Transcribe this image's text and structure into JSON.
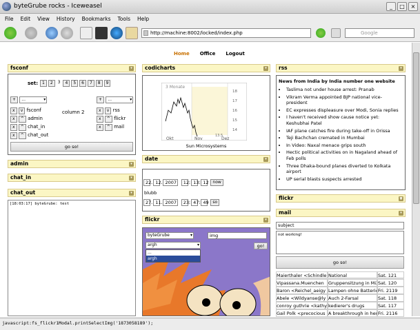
{
  "window": {
    "title": "byteGrube rocks - Iceweasel",
    "btn_min": "_",
    "btn_max": "□",
    "btn_close": "×"
  },
  "menu": [
    "File",
    "Edit",
    "View",
    "History",
    "Bookmarks",
    "Tools",
    "Help"
  ],
  "url": "http://machine:8002/locked/index.php",
  "search_placeholder": "Google",
  "nav": {
    "home": "Home",
    "office": "Office",
    "logout": "Logout"
  },
  "fsconf": {
    "title": "fsconf",
    "set_label": "set:",
    "sets": [
      "1",
      "2",
      "3",
      "4",
      "5",
      "6",
      "7",
      "8",
      "9"
    ],
    "col1_select": "...",
    "col2_label": "column 2",
    "col3_select": "...",
    "col1_items": [
      "fsconf",
      "admin",
      "chat_in",
      "chat_out"
    ],
    "col3_items": [
      "rss",
      "flickr",
      "mail"
    ],
    "go": "go so!"
  },
  "admin": {
    "title": "admin"
  },
  "chat_in": {
    "title": "chat_in"
  },
  "chat_out": {
    "title": "chat_out",
    "line": "[18:03:17] byteGrube: test"
  },
  "codicharts": {
    "title": "codicharts",
    "label": "3 Monate",
    "yticks": [
      "18",
      "17",
      "16",
      "15",
      "14",
      "13.5"
    ],
    "xticks": [
      "Okt",
      "Nov",
      "Dez"
    ],
    "caption": "Sun Microsystems"
  },
  "date": {
    "title": "date",
    "row1": [
      "22",
      "12",
      "2007",
      "12",
      "13",
      "12"
    ],
    "now": "now",
    "note": "blubb",
    "row2": [
      "27",
      "11",
      "2007",
      "23",
      "47",
      "49"
    ],
    "so": "so"
  },
  "flickr_mid": {
    "title": "flickr",
    "user": "byteGrube",
    "img": "img",
    "sel": "argh",
    "go": "go!",
    "opt1": "...",
    "opt2": "argh"
  },
  "rss": {
    "title": "rss",
    "heading": "News from India by India number one website",
    "items": [
      "Taslima not under house arrest: Pranab",
      "Vikram Verma appointed BJP national vice-president",
      "EC expresses displeasure over Modi, Sonia replies",
      "I haven't received show cause notice yet: Keshubhai Patel",
      "IAF plane catches fire during take-off in Orissa",
      "Teji Bachchan cremated in Mumbai",
      "In Video: Naxal menace grips south",
      "Hectic political activities on in Nagaland ahead of Feb polls",
      "Three Dhaka-bound planes diverted to Kolkata airport",
      "UP serial blasts suspects arrested"
    ]
  },
  "flickr_right": {
    "title": "flickr"
  },
  "mail": {
    "title": "mail",
    "subject_ph": "subject",
    "body": "not working!",
    "go": "go so!",
    "rows": [
      [
        "Maierthaler <Schindle",
        "National",
        "Sat. 121"
      ],
      [
        "Vipassana.Muenchen",
        "Gruppensitzung in Mü",
        "Sat. 120"
      ],
      [
        "Baron <Reichel_aeigy",
        "Lampen ohne Batterie",
        "Fri. 2119"
      ],
      [
        "Abele <Wildyanse@ly",
        "Auch 2-Farsal",
        "Sat. 118"
      ],
      [
        "conroy guthrie <kathy",
        "kedierer's drugs",
        "Sat. 117"
      ],
      [
        "Gail Polk <precocious",
        "A breakthrough in her",
        "Fri. 2116"
      ]
    ]
  },
  "status": "javascript:fs_flickr1Modal.printSelectImg('1873058189');"
}
